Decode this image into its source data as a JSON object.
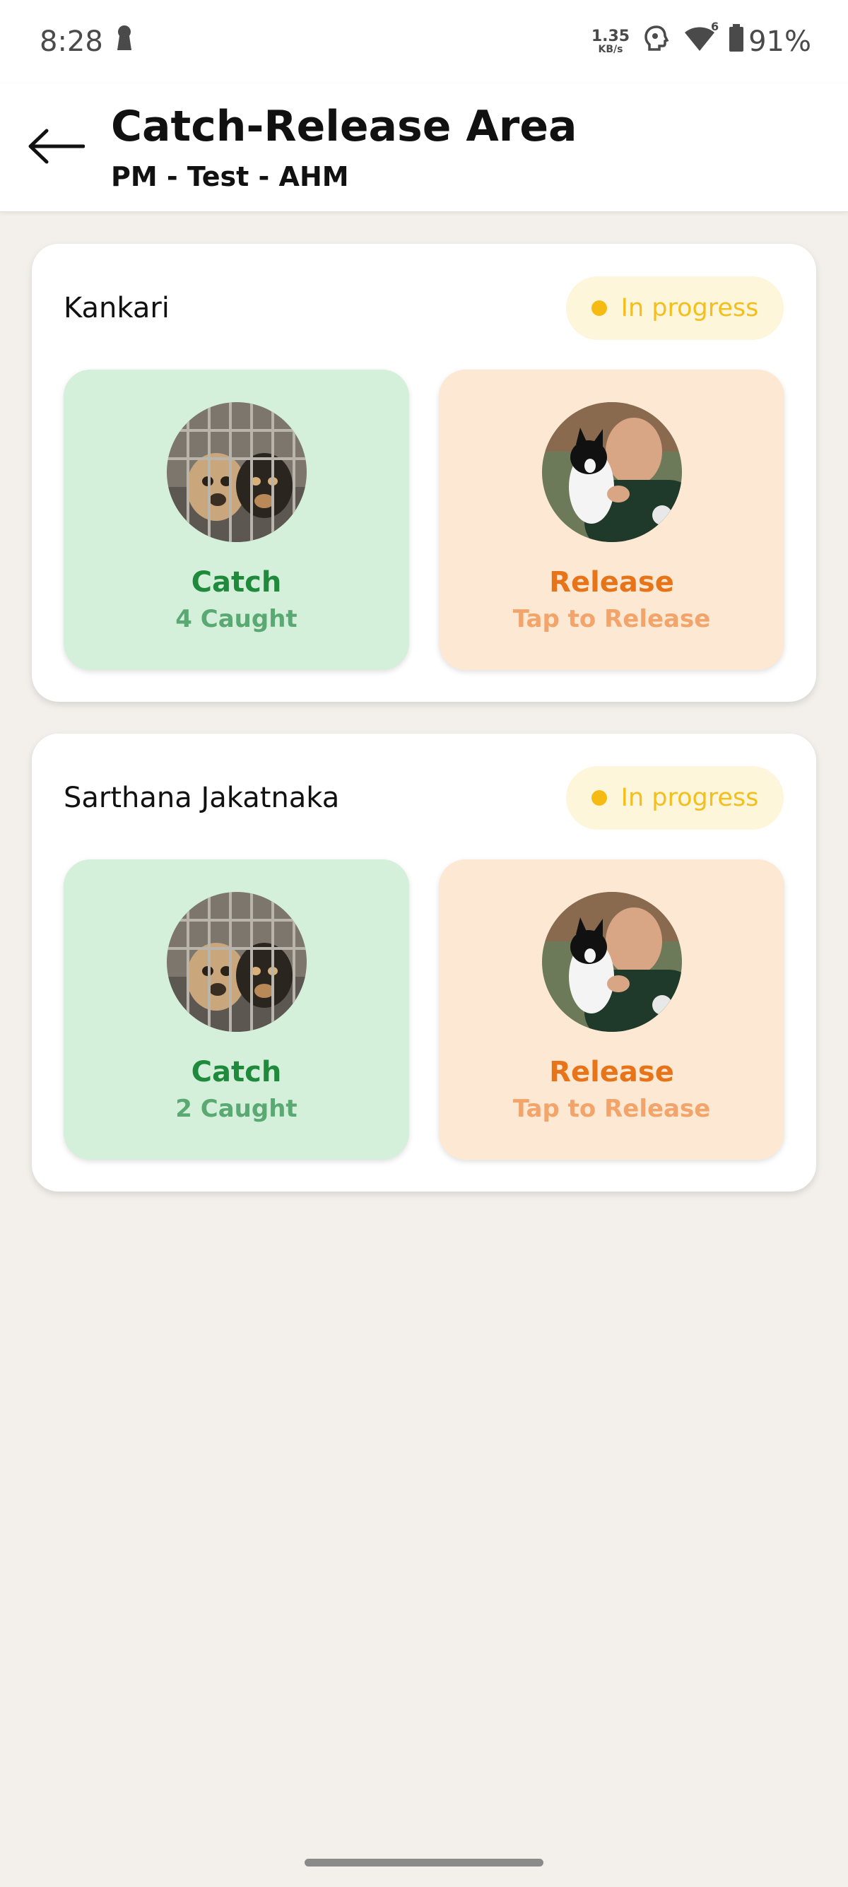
{
  "status_bar": {
    "time": "8:28",
    "net_speed_value": "1.35",
    "net_speed_unit": "KB/s",
    "signal_badge": "6",
    "battery": "91%"
  },
  "header": {
    "title": "Catch-Release Area",
    "subtitle": "PM - Test - AHM"
  },
  "areas": [
    {
      "name": "Kankari",
      "status": "In progress",
      "catch": {
        "label": "Catch",
        "detail": "4 Caught"
      },
      "release": {
        "label": "Release",
        "detail": "Tap to Release"
      }
    },
    {
      "name": "Sarthana Jakatnaka",
      "status": "In progress",
      "catch": {
        "label": "Catch",
        "detail": "2 Caught"
      },
      "release": {
        "label": "Release",
        "detail": "Tap to Release"
      }
    }
  ],
  "colors": {
    "catch_bg": "#d4f0db",
    "catch_text": "#1f8a3c",
    "release_bg": "#fde9d3",
    "release_text": "#e8741a",
    "status_text": "#f4bf1c",
    "status_bg": "#fdf6da"
  },
  "icons": {
    "back": "arrow-left-icon",
    "catch_photo": "puppies-in-cage-photo",
    "release_photo": "man-holding-dog-photo"
  }
}
